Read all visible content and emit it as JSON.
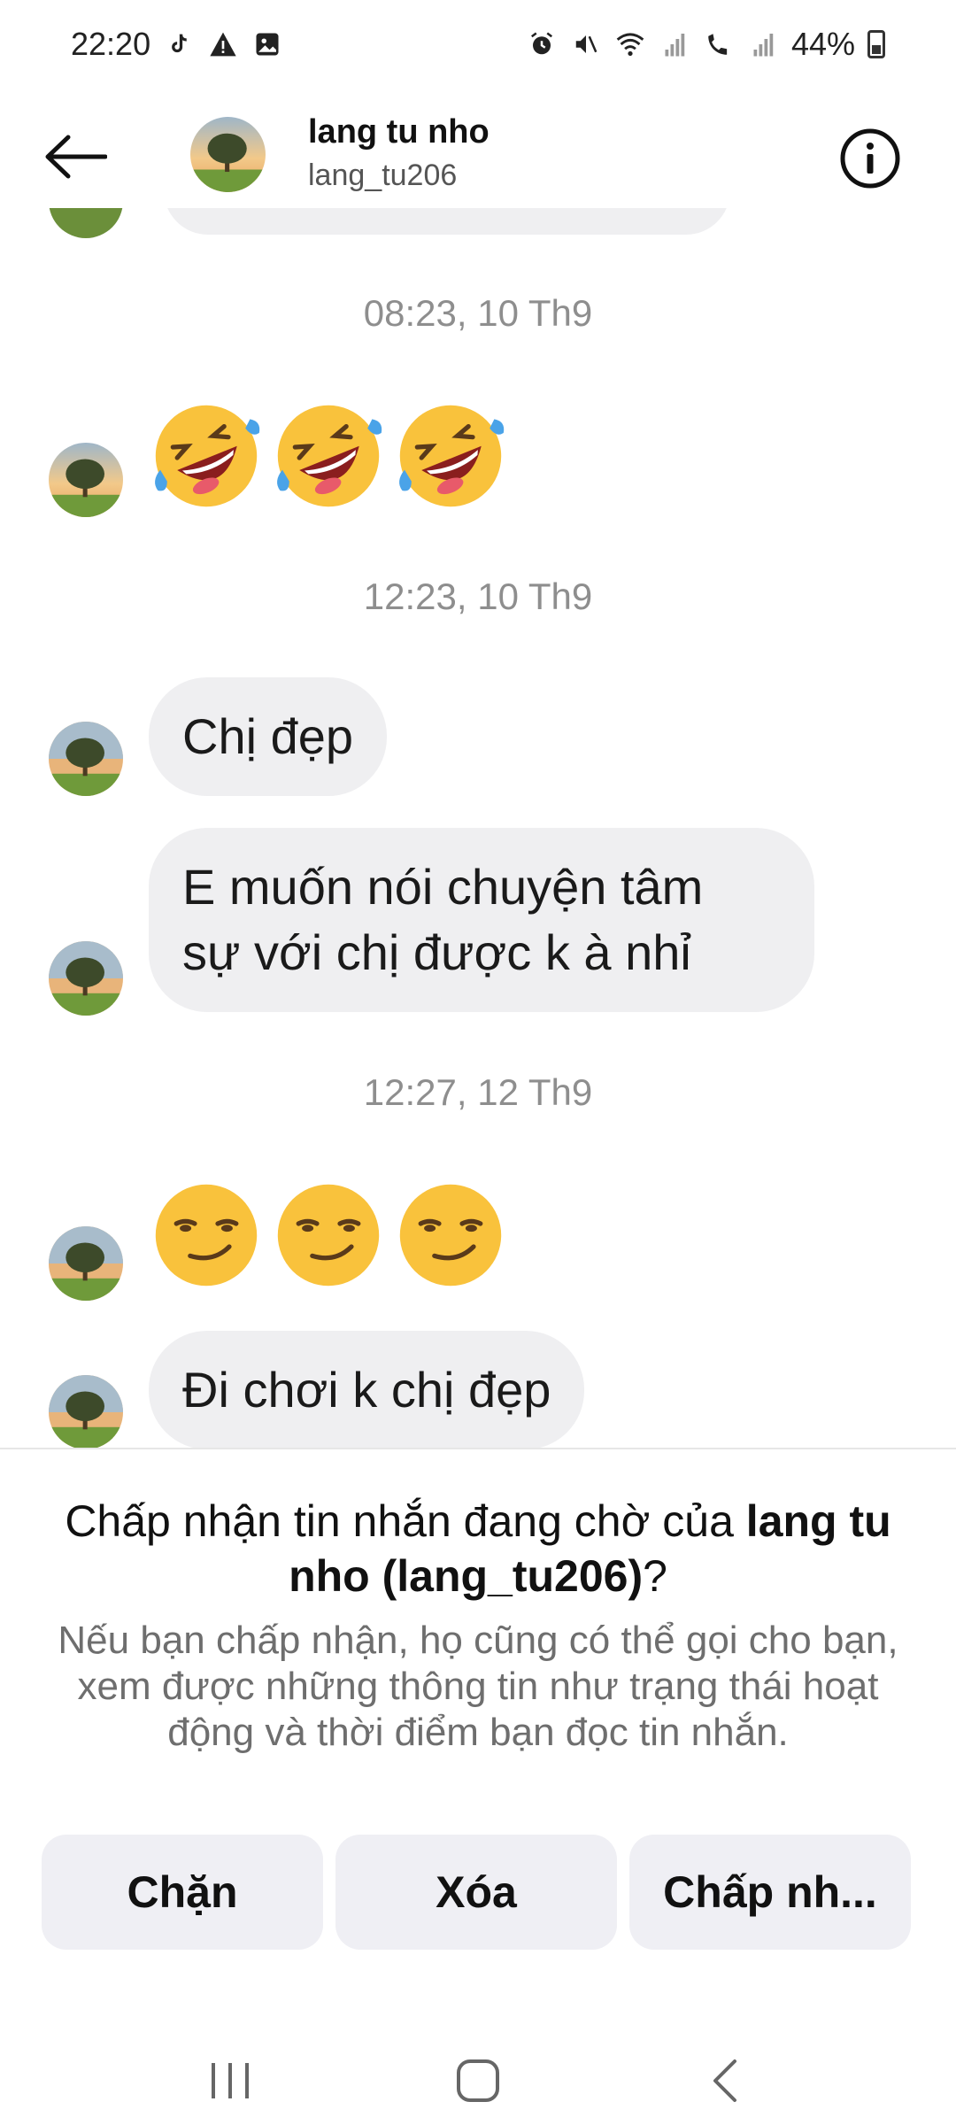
{
  "status_bar": {
    "time": "22:20",
    "left_icons": [
      "tiktok-icon",
      "warning-icon",
      "image-icon"
    ],
    "right_icons": [
      "alarm-icon",
      "mute-icon",
      "wifi-icon",
      "signal-icon",
      "wifi-call-icon",
      "signal-icon"
    ],
    "battery": "44%"
  },
  "header": {
    "name": "lang tu nho",
    "username": "lang_tu206"
  },
  "messages": {
    "ts1": "08:23, 10 Th9",
    "ts2": "12:23, 10 Th9",
    "msg1": "Chị đẹp",
    "msg2_line1": "E muốn nói chuyện tâm",
    "msg2_line2": "sự với chị được k à nhỉ",
    "ts3": "12:27, 12 Th9",
    "msg3": "Đi chơi k chị đẹp",
    "emoji_group1": [
      "rofl-emoji",
      "rofl-emoji",
      "rofl-emoji"
    ],
    "emoji_group2": [
      "smirk-emoji",
      "smirk-emoji",
      "smirk-emoji"
    ]
  },
  "request": {
    "title_prefix": "Chấp nhận tin nhắn đang chờ của ",
    "title_name": "lang tu nho (lang_tu206)",
    "title_suffix": "?",
    "description": "Nếu bạn chấp nhận, họ cũng có thể gọi cho bạn, xem được những thông tin như trạng thái hoạt động và thời điểm bạn đọc tin nhắn.",
    "block_label": "Chặn",
    "delete_label": "Xóa",
    "accept_label": "Chấp nh..."
  },
  "colors": {
    "bubble": "#efeff1",
    "timestamp": "#8e8e8e",
    "button_bg": "#efeff4"
  }
}
